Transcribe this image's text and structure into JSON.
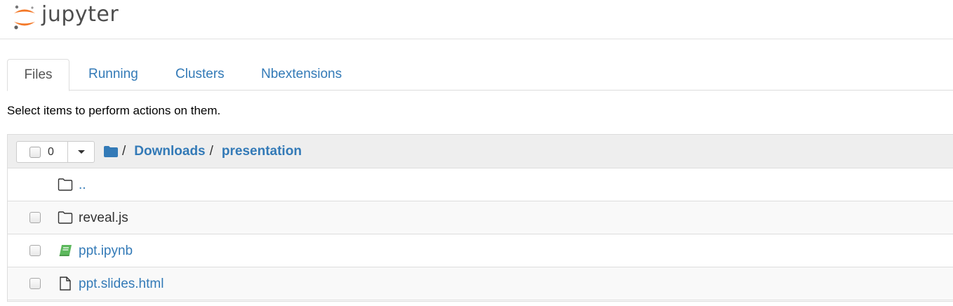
{
  "app": {
    "logo_text": "jupyter"
  },
  "tabs": [
    {
      "label": "Files",
      "active": true
    },
    {
      "label": "Running",
      "active": false
    },
    {
      "label": "Clusters",
      "active": false
    },
    {
      "label": "Nbextensions",
      "active": false
    }
  ],
  "hint": "Select items to perform actions on them.",
  "toolbar": {
    "selected_count": "0"
  },
  "breadcrumb": {
    "separator": "/",
    "items": [
      "Downloads",
      "presentation"
    ]
  },
  "files": [
    {
      "name": "..",
      "type": "parent",
      "icon": "folder-icon"
    },
    {
      "name": "reveal.js",
      "type": "folder",
      "icon": "folder-icon"
    },
    {
      "name": "ppt.ipynb",
      "type": "notebook",
      "icon": "notebook-icon"
    },
    {
      "name": "ppt.slides.html",
      "type": "file",
      "icon": "file-icon"
    }
  ],
  "colors": {
    "link": "#337ab7",
    "logo_orange": "#f37726",
    "notebook_green": "#5cb85c",
    "header_bg": "#eeeeee"
  }
}
